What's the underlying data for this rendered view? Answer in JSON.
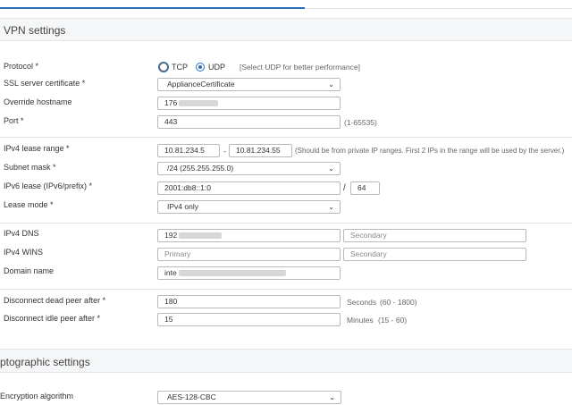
{
  "vpn": {
    "title": "VPN settings",
    "protocol": {
      "label": "Protocol *",
      "tcp": "TCP",
      "udp": "UDP",
      "hint": "[Select UDP for better performance]"
    },
    "ssl_cert": {
      "label": "SSL server certificate *",
      "value": "ApplianceCertificate"
    },
    "override_hostname": {
      "label": "Override hostname",
      "value": "176"
    },
    "port": {
      "label": "Port *",
      "value": "443",
      "hint": "(1-65535)"
    },
    "ipv4_lease": {
      "label": "IPv4 lease range *",
      "start": "10.81.234.5",
      "dash": "-",
      "end": "10.81.234.55",
      "hint": "(Should be from private IP ranges. First 2 IPs in the range will be used by the server.)"
    },
    "subnet": {
      "label": "Subnet mask *",
      "value": "/24 (255.255.255.0)"
    },
    "ipv6_lease": {
      "label": "IPv6 lease (IPv6/prefix) *",
      "value": "2001:db8::1:0",
      "slash": "/",
      "prefix": "64"
    },
    "lease_mode": {
      "label": "Lease mode *",
      "value": "IPv4 only"
    },
    "ipv4_dns": {
      "label": "IPv4 DNS",
      "primary": "192",
      "secondary_placeholder": "Secondary"
    },
    "ipv4_wins": {
      "label": "IPv4 WINS",
      "primary_placeholder": "Primary",
      "secondary_placeholder": "Secondary"
    },
    "domain": {
      "label": "Domain name",
      "value": "inte"
    },
    "dead_peer": {
      "label": "Disconnect dead peer after *",
      "value": "180",
      "unit": "Seconds",
      "range": "(60 - 1800)"
    },
    "idle_peer": {
      "label": "Disconnect idle peer after *",
      "value": "15",
      "unit": "Minutes",
      "range": "(15 - 60)"
    }
  },
  "crypto": {
    "title": "ptographic settings",
    "encryption": {
      "label": "Encryption algorithm",
      "value": "AES-128-CBC"
    }
  }
}
